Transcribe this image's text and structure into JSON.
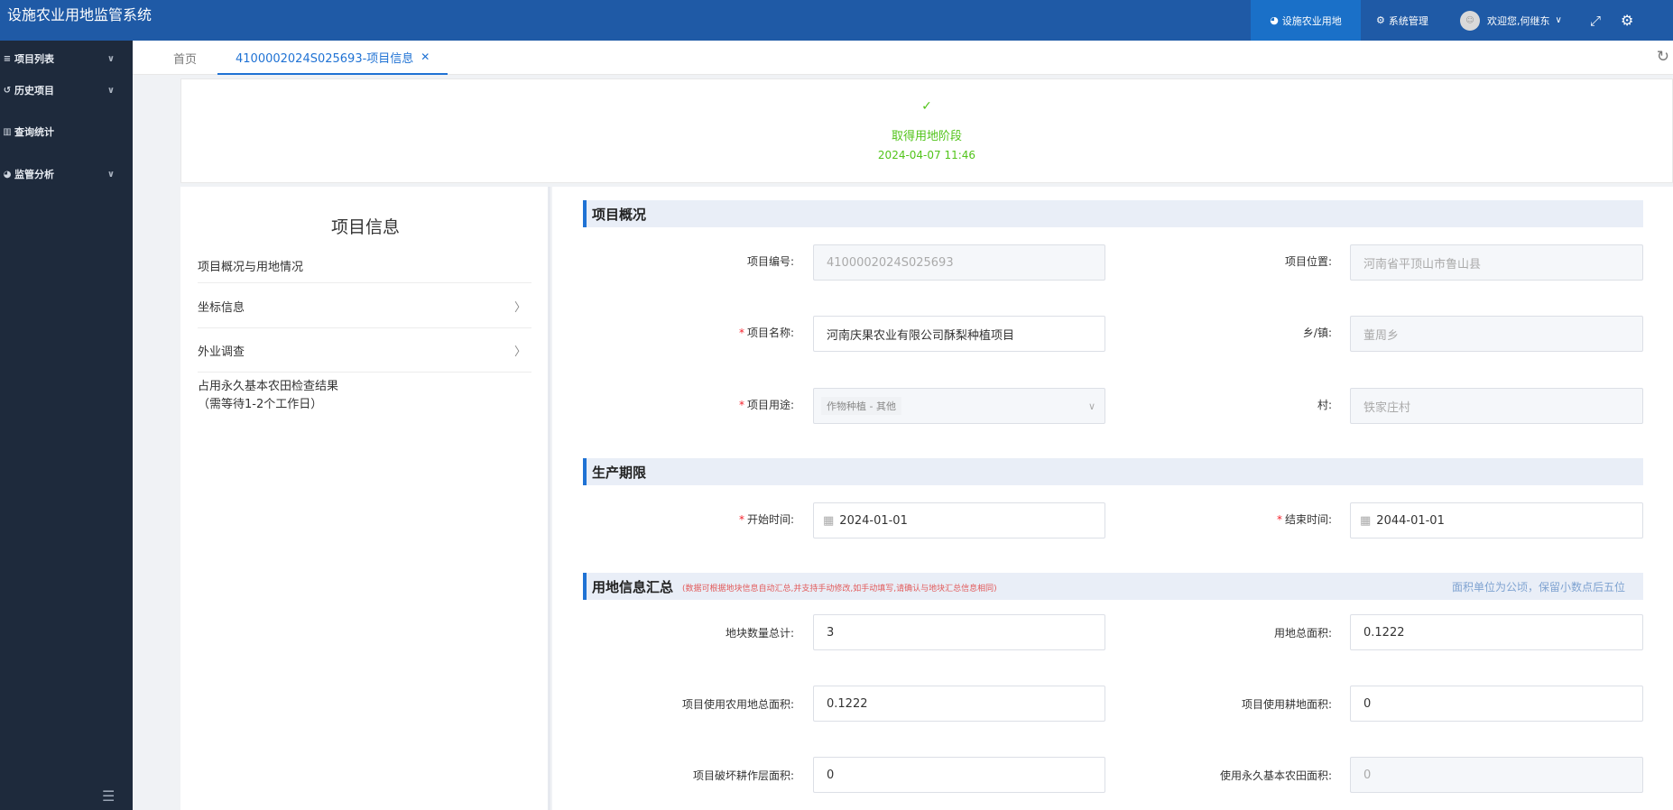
{
  "header": {
    "app_title": "设施农业用地监管系统",
    "nav": [
      {
        "label": "设施农业用地",
        "icon": "pie-chart-icon"
      },
      {
        "label": "系统管理",
        "icon": "settings-icon"
      }
    ],
    "user_greeting": "欢迎您,何继东"
  },
  "sidebar": {
    "items": [
      {
        "label": "项目列表",
        "icon": "list-icon"
      },
      {
        "label": "历史项目",
        "icon": "history-icon"
      },
      {
        "label": "查询统计",
        "icon": "bar-chart-icon"
      },
      {
        "label": "监管分析",
        "icon": "pie-chart-icon"
      }
    ]
  },
  "tabs": [
    {
      "label": "首页"
    },
    {
      "label": "4100002024S025693-项目信息"
    }
  ],
  "stage": {
    "title": "取得用地阶段",
    "time": "2024-04-07 11:46"
  },
  "left_panel": {
    "title": "项目信息",
    "items": [
      {
        "label": "项目概况与用地情况"
      },
      {
        "label": "坐标信息"
      },
      {
        "label": "外业调查"
      },
      {
        "label": "占用永久基本农田检查结果",
        "sub": "（需等待1-2个工作日）"
      }
    ]
  },
  "sections": {
    "overview": {
      "title": "项目概况",
      "fields": {
        "code": {
          "label": "项目编号:",
          "value": "4100002024S025693"
        },
        "location": {
          "label": "项目位置:",
          "value": "河南省平顶山市鲁山县"
        },
        "name": {
          "label": "项目名称:",
          "value": "河南庆果农业有限公司酥梨种植项目"
        },
        "town": {
          "label": "乡/镇:",
          "value": "董周乡"
        },
        "purpose": {
          "label": "项目用途:",
          "value": "作物种植 - 其他"
        },
        "village": {
          "label": "村:",
          "value": "铁家庄村"
        }
      }
    },
    "period": {
      "title": "生产期限",
      "fields": {
        "start": {
          "label": "开始时间:",
          "value": "2024-01-01"
        },
        "end": {
          "label": "结束时间:",
          "value": "2044-01-01"
        }
      }
    },
    "land": {
      "title": "用地信息汇总",
      "note": "(数据可根据地块信息自动汇总,并支持手动修改,如手动填写,请确认与地块汇总信息相同)",
      "unit_note": "面积单位为公顷，保留小数点后五位",
      "fields": {
        "parcel_count": {
          "label": "地块数量总计:",
          "value": "3"
        },
        "total_area": {
          "label": "用地总面积:",
          "value": "0.1222"
        },
        "agri_area": {
          "label": "项目使用农用地总面积:",
          "value": "0.1222"
        },
        "farmland_area": {
          "label": "项目使用耕地面积:",
          "value": "0"
        },
        "damage_area": {
          "label": "项目破坏耕作层面积:",
          "value": "0"
        },
        "basic_farmland_area": {
          "label": "使用永久基本农田面积:",
          "value": "0"
        }
      }
    }
  }
}
